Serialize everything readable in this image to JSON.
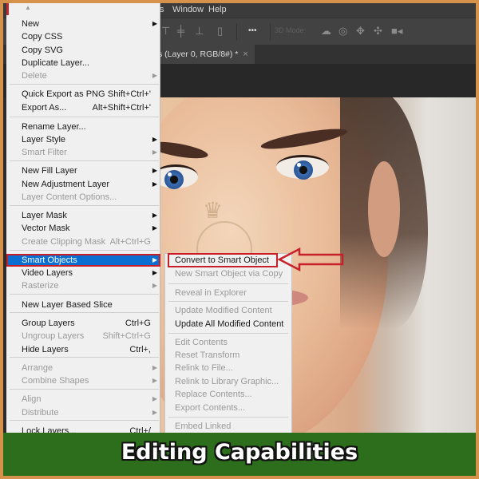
{
  "app": {
    "menubar": [
      "s",
      "Window",
      "Help"
    ],
    "options_bar": {
      "mode_3d_label": "3D Mode:",
      "more_label": "•••"
    },
    "document_tab": {
      "title": "s (Layer 0, RGB/8#) *",
      "close_glyph": "×"
    }
  },
  "context_menu": {
    "scroll_up_glyph": "▲",
    "items": [
      {
        "label": "New",
        "shortcut": "",
        "submenu": true,
        "disabled": false
      },
      {
        "label": "Copy CSS",
        "shortcut": "",
        "submenu": false,
        "disabled": false
      },
      {
        "label": "Copy SVG",
        "shortcut": "",
        "submenu": false,
        "disabled": false
      },
      {
        "label": "Duplicate Layer...",
        "shortcut": "",
        "submenu": false,
        "disabled": false
      },
      {
        "label": "Delete",
        "shortcut": "",
        "submenu": true,
        "disabled": true
      },
      {
        "label": "Quick Export as PNG",
        "shortcut": "Shift+Ctrl+'",
        "submenu": false,
        "disabled": false
      },
      {
        "label": "Export As...",
        "shortcut": "Alt+Shift+Ctrl+'",
        "submenu": false,
        "disabled": false
      },
      {
        "label": "Rename Layer...",
        "shortcut": "",
        "submenu": false,
        "disabled": false
      },
      {
        "label": "Layer Style",
        "shortcut": "",
        "submenu": true,
        "disabled": false
      },
      {
        "label": "Smart Filter",
        "shortcut": "",
        "submenu": true,
        "disabled": true
      },
      {
        "label": "New Fill Layer",
        "shortcut": "",
        "submenu": true,
        "disabled": false
      },
      {
        "label": "New Adjustment Layer",
        "shortcut": "",
        "submenu": true,
        "disabled": false
      },
      {
        "label": "Layer Content Options...",
        "shortcut": "",
        "submenu": false,
        "disabled": true
      },
      {
        "label": "Layer Mask",
        "shortcut": "",
        "submenu": true,
        "disabled": false
      },
      {
        "label": "Vector Mask",
        "shortcut": "",
        "submenu": true,
        "disabled": false
      },
      {
        "label": "Create Clipping Mask",
        "shortcut": "Alt+Ctrl+G",
        "submenu": false,
        "disabled": true
      },
      {
        "label": "Smart Objects",
        "shortcut": "",
        "submenu": true,
        "disabled": false,
        "highlighted": true
      },
      {
        "label": "Video Layers",
        "shortcut": "",
        "submenu": true,
        "disabled": false
      },
      {
        "label": "Rasterize",
        "shortcut": "",
        "submenu": true,
        "disabled": true
      },
      {
        "label": "New Layer Based Slice",
        "shortcut": "",
        "submenu": false,
        "disabled": false
      },
      {
        "label": "Group Layers",
        "shortcut": "Ctrl+G",
        "submenu": false,
        "disabled": false
      },
      {
        "label": "Ungroup Layers",
        "shortcut": "Shift+Ctrl+G",
        "submenu": false,
        "disabled": true
      },
      {
        "label": "Hide Layers",
        "shortcut": "Ctrl+,",
        "submenu": false,
        "disabled": false
      },
      {
        "label": "Arrange",
        "shortcut": "",
        "submenu": true,
        "disabled": true
      },
      {
        "label": "Combine Shapes",
        "shortcut": "",
        "submenu": true,
        "disabled": true
      },
      {
        "label": "Align",
        "shortcut": "",
        "submenu": true,
        "disabled": true
      },
      {
        "label": "Distribute",
        "shortcut": "",
        "submenu": true,
        "disabled": true
      },
      {
        "label": "Lock Layers...",
        "shortcut": "Ctrl+/",
        "submenu": false,
        "disabled": false
      }
    ]
  },
  "submenu": {
    "items": [
      {
        "label": "Convert to Smart Object",
        "disabled": false,
        "boxed": true
      },
      {
        "label": "New Smart Object via Copy",
        "disabled": true
      },
      {
        "label": "Reveal in Explorer",
        "disabled": true
      },
      {
        "label": "Update Modified Content",
        "disabled": true
      },
      {
        "label": "Update All Modified Content",
        "disabled": false
      },
      {
        "label": "Edit Contents",
        "disabled": true
      },
      {
        "label": "Reset Transform",
        "disabled": true
      },
      {
        "label": "Relink to File...",
        "disabled": true
      },
      {
        "label": "Relink to Library Graphic...",
        "disabled": true
      },
      {
        "label": "Replace Contents...",
        "disabled": true
      },
      {
        "label": "Export Contents...",
        "disabled": true
      },
      {
        "label": "Embed Linked",
        "disabled": true
      }
    ]
  },
  "banner": {
    "title": "Editing Capabilities"
  },
  "colors": {
    "frame_border": "#d6914a",
    "banner_bg": "#2c6e1c",
    "highlight": "#0a6fd1",
    "callout_red": "#c8202a"
  }
}
